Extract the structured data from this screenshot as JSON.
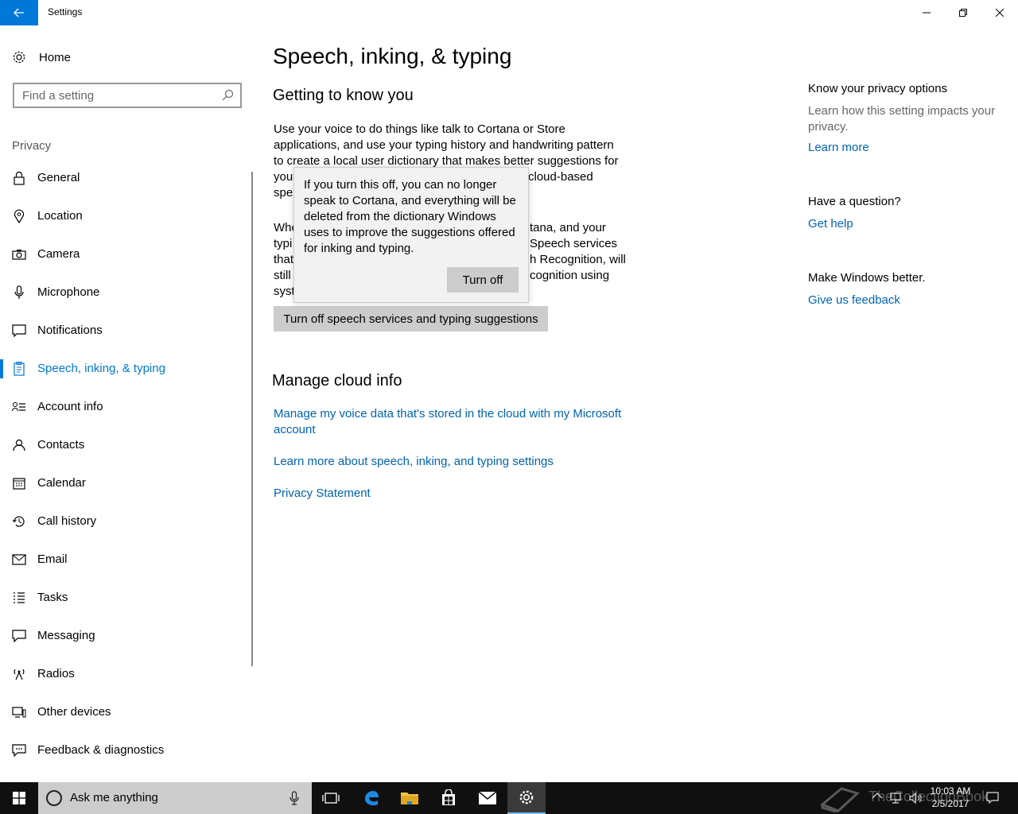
{
  "window": {
    "title": "Settings"
  },
  "sidebar": {
    "home_label": "Home",
    "search_placeholder": "Find a setting",
    "section": "Privacy",
    "items": [
      {
        "label": "General",
        "icon": "lock-icon"
      },
      {
        "label": "Location",
        "icon": "location-icon"
      },
      {
        "label": "Camera",
        "icon": "camera-icon"
      },
      {
        "label": "Microphone",
        "icon": "microphone-icon"
      },
      {
        "label": "Notifications",
        "icon": "notifications-icon"
      },
      {
        "label": "Speech, inking, & typing",
        "icon": "clipboard-icon",
        "active": true
      },
      {
        "label": "Account info",
        "icon": "account-info-icon"
      },
      {
        "label": "Contacts",
        "icon": "contacts-icon"
      },
      {
        "label": "Calendar",
        "icon": "calendar-icon"
      },
      {
        "label": "Call history",
        "icon": "history-icon"
      },
      {
        "label": "Email",
        "icon": "email-icon"
      },
      {
        "label": "Tasks",
        "icon": "tasks-icon"
      },
      {
        "label": "Messaging",
        "icon": "messaging-icon"
      },
      {
        "label": "Radios",
        "icon": "radio-icon"
      },
      {
        "label": "Other devices",
        "icon": "devices-icon"
      },
      {
        "label": "Feedback & diagnostics",
        "icon": "feedback-icon"
      }
    ]
  },
  "main": {
    "title": "Speech, inking, & typing",
    "getting_to_know_heading": "Getting to know you",
    "para1_visible": [
      "Use your voice to do things like talk to Cortana or Store",
      "applications, and use your typing history and handwriting pattern",
      "to create a local user dictionary that makes better suggestions for",
      "you",
      "cloud-based",
      "spe"
    ],
    "para2_visible": [
      "Whe",
      "tana, and your",
      "typi",
      "Speech services",
      "that",
      "h Recognition, will",
      "still",
      "cognition using",
      "syst"
    ],
    "turn_off_all_button": "Turn off speech services and typing suggestions",
    "manage_heading": "Manage cloud info",
    "link_manage_voice_1": "Manage my voice data that's stored in the cloud with my Microsoft",
    "link_manage_voice_2": "account",
    "link_learn_more": "Learn more about speech, inking, and typing settings",
    "link_privacy": "Privacy Statement"
  },
  "flyout": {
    "text": "If you turn this off, you can no longer speak to Cortana, and everything will be deleted from the dictionary Windows uses to improve the suggestions offered for inking and typing.",
    "button": "Turn off"
  },
  "right": {
    "privacy_heading": "Know your privacy options",
    "privacy_text": "Learn how this setting impacts your privacy.",
    "learn_more": "Learn more",
    "question_heading": "Have a question?",
    "get_help": "Get help",
    "better_heading": "Make Windows better.",
    "feedback": "Give us feedback"
  },
  "taskbar": {
    "search_text": "Ask me anything",
    "watermark": "TheCollectionBook",
    "time": "10:03 AM",
    "date": "2/5/2017"
  },
  "colors": {
    "accent": "#0078d7",
    "link": "#0063b1"
  }
}
